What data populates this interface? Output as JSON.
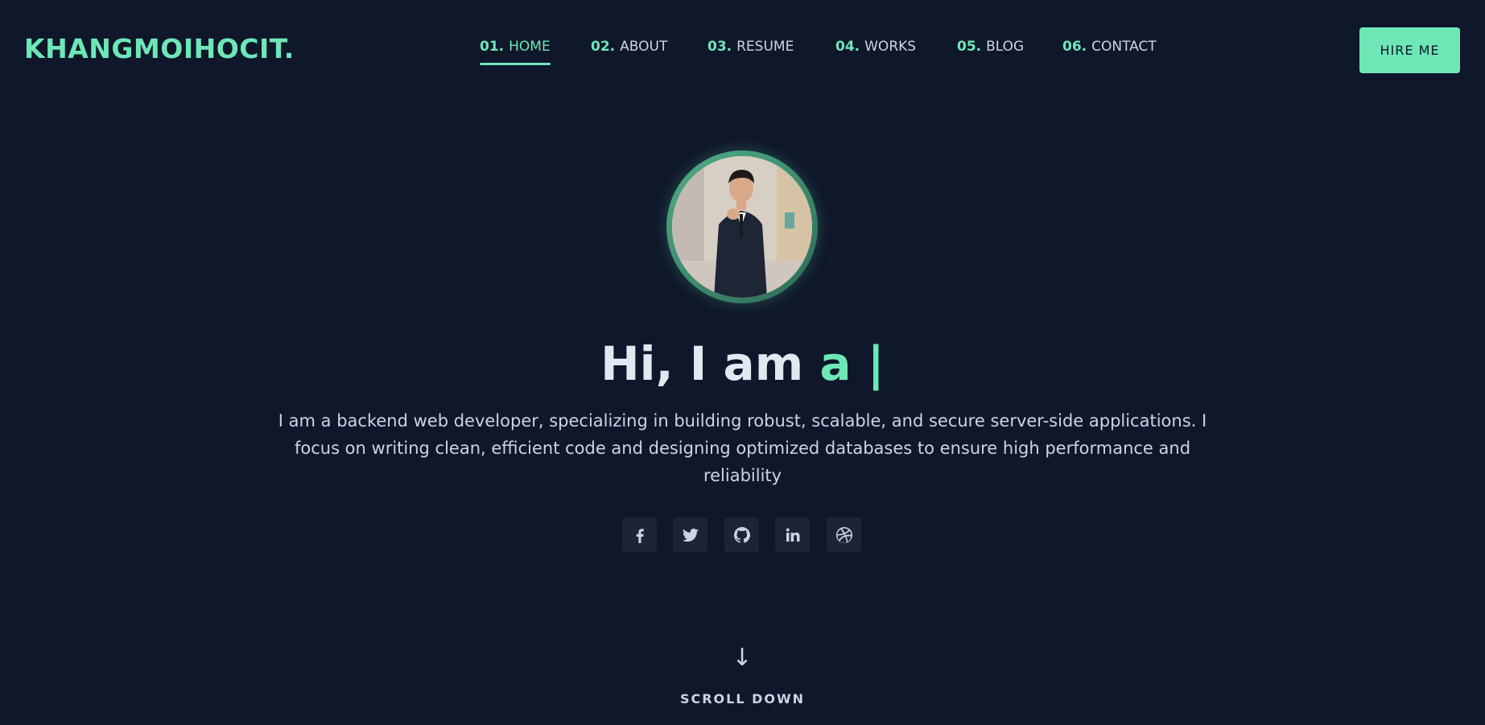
{
  "brand": {
    "logo": "KHANGMOIHOCIT."
  },
  "nav": {
    "items": [
      {
        "num": "01.",
        "label": "HOME",
        "active": true
      },
      {
        "num": "02.",
        "label": "ABOUT"
      },
      {
        "num": "03.",
        "label": "RESUME"
      },
      {
        "num": "04.",
        "label": "WORKS"
      },
      {
        "num": "05.",
        "label": "BLOG"
      },
      {
        "num": "06.",
        "label": "CONTACT"
      }
    ],
    "hire_label": "HIRE ME"
  },
  "hero": {
    "greeting": "Hi, I am ",
    "typed": "a |",
    "bio": "I am a backend web developer, specializing in building robust, scalable, and secure server-side applications. I focus on writing clean, efficient code and designing optimized databases to ensure high performance and reliability",
    "socials": [
      "facebook-icon",
      "twitter-icon",
      "github-icon",
      "linkedin-icon",
      "dribbble-icon"
    ]
  },
  "scroll": {
    "arrow": "↓",
    "label": "SCROLL DOWN"
  },
  "colors": {
    "background": "#0f172a",
    "accent": "#6ee7b7",
    "text": "#cbd5e1",
    "social_bg": "#1b2537"
  }
}
